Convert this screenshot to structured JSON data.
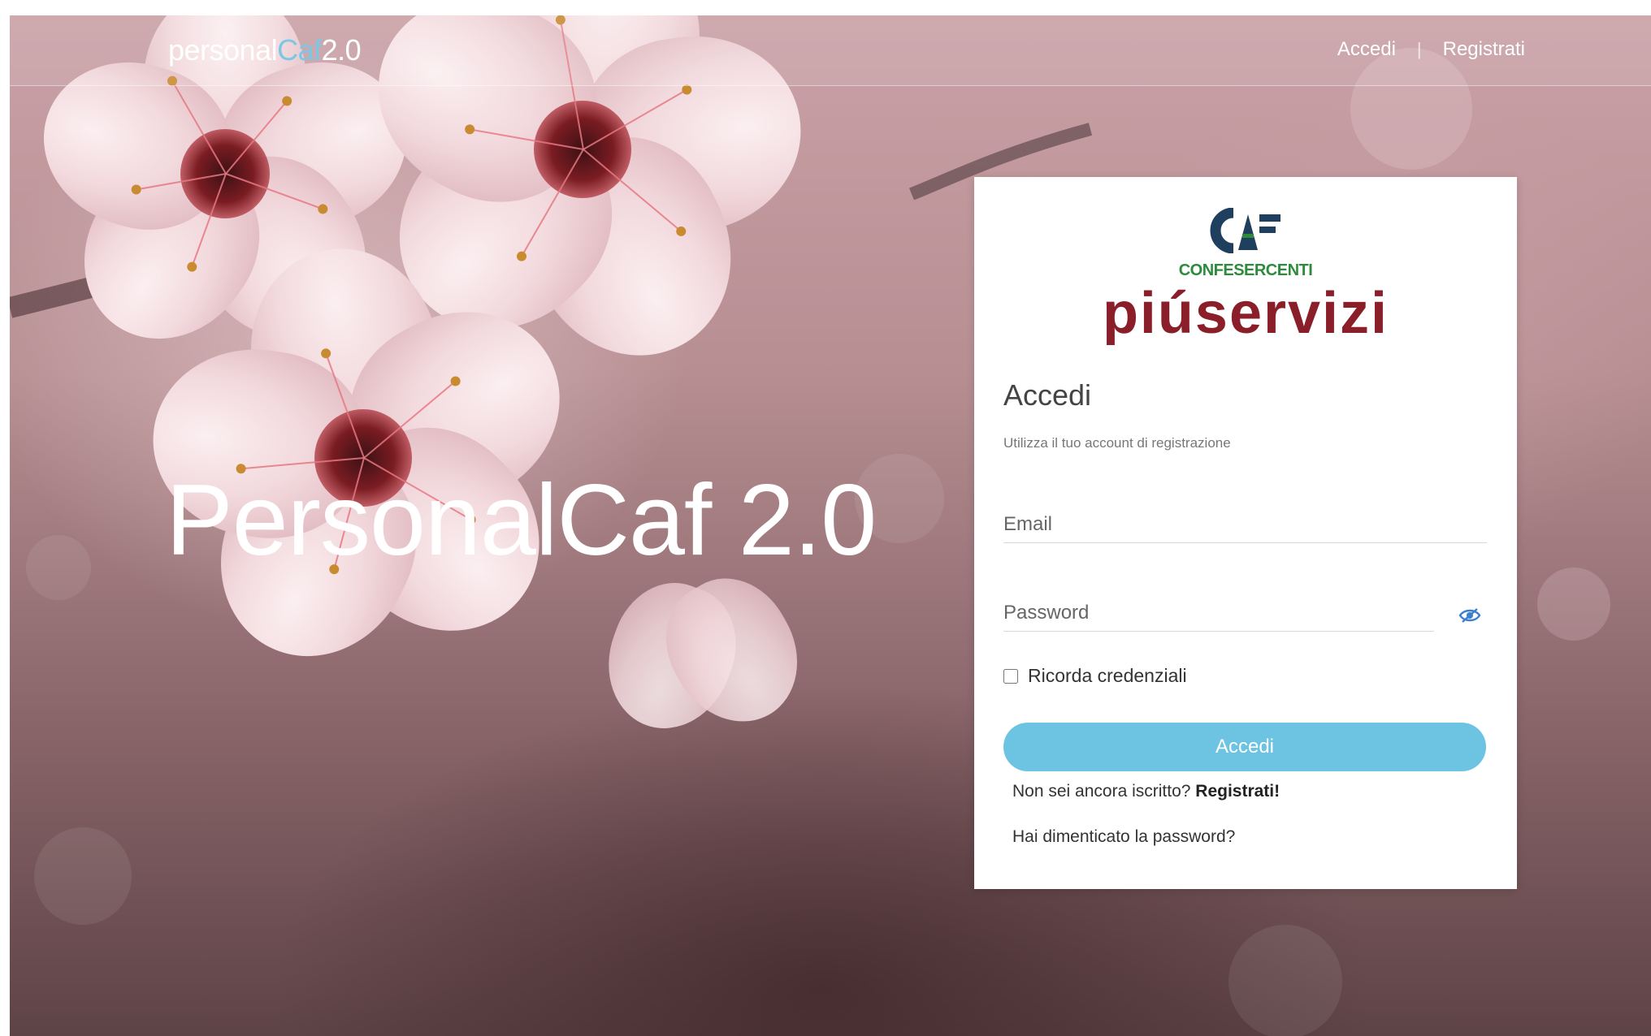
{
  "header": {
    "brand": {
      "part1": "personal",
      "part2": "Caf",
      "part3": "2.0"
    },
    "nav": {
      "login_label": "Accedi",
      "separator": "|",
      "register_label": "Registrati"
    }
  },
  "hero": {
    "title": "PersonalCaf 2.0"
  },
  "login_card": {
    "logo": {
      "top_text": "CAF",
      "middle_text": "CONFESERCENTI",
      "bottom_text": "piúservizi"
    },
    "title": "Accedi",
    "subtitle": "Utilizza il tuo account di registrazione",
    "email": {
      "placeholder": "Email",
      "value": ""
    },
    "password": {
      "placeholder": "Password",
      "value": ""
    },
    "remember_label": "Ricorda credenziali",
    "remember_checked": false,
    "submit_label": "Accedi",
    "signup_prompt": "Non sei ancora iscritto?",
    "signup_link": "Registrati!",
    "forgot_link": "Hai dimenticato la password?"
  },
  "icons": {
    "password_toggle": "eye-slash-icon"
  },
  "colors": {
    "accent": "#6cc3e2",
    "brand_caf": "#7ac7e6",
    "logo_green": "#2e8a3c",
    "logo_navy": "#1f3f5e",
    "logo_red": "#8a1f2a"
  }
}
